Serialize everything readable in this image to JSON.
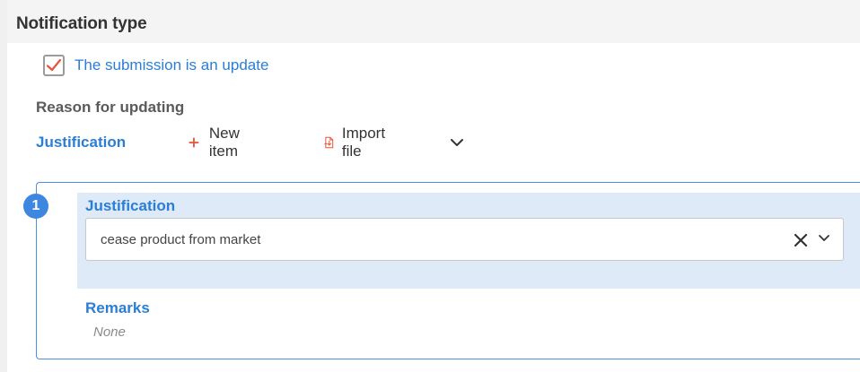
{
  "header": {
    "title": "Notification type"
  },
  "update_checkbox": {
    "checked": true,
    "label": "The submission is an update",
    "check_color": "#e8533a"
  },
  "reason": {
    "label": "Reason for updating"
  },
  "toolbar": {
    "title": "Justification",
    "new_item_label": "New item",
    "import_file_label": "Import file",
    "new_item_icon": "plus-icon",
    "import_file_icon": "import-file-icon",
    "menu_icon": "chevron-down-icon"
  },
  "item": {
    "index": "1",
    "justification_label": "Justification",
    "justification_value": "cease product from market",
    "remarks_label": "Remarks",
    "remarks_value": "None"
  },
  "colors": {
    "accent_blue": "#2a7ed6",
    "accent_orange": "#e8533a",
    "panel_blue": "#dfeaf8",
    "header_gray": "#f4f4f4"
  }
}
